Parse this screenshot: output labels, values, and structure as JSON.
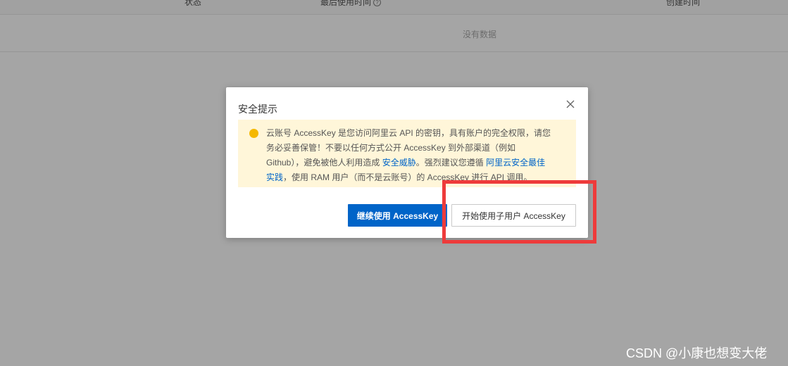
{
  "table": {
    "columns": {
      "status": "状态",
      "last_used": "最后使用时间",
      "created": "创建时间"
    },
    "empty_text": "没有数据"
  },
  "dialog": {
    "title": "安全提示",
    "alert": {
      "part1": "云账号 AccessKey 是您访问阿里云 API 的密钥，具有账户的完全权限，请您务必妥善保管！不要以任何方式公开 AccessKey 到外部渠道（例如 Github），避免被他人利用造成 ",
      "link1": "安全威胁",
      "part2": "。强烈建议您遵循 ",
      "link2": "阿里云安全最佳实践",
      "part3": "，使用 RAM 用户（而不是云账号）的 AccessKey 进行 API 调用。"
    },
    "buttons": {
      "continue": "继续使用 AccessKey",
      "sub_user": "开始使用子用户 AccessKey"
    }
  },
  "colors": {
    "primary": "#0064c8",
    "warning_bg": "#fff6d9",
    "warning_icon": "#f5b800",
    "highlight": "#ee3b3b"
  },
  "watermark": "CSDN @小康也想变大佬"
}
